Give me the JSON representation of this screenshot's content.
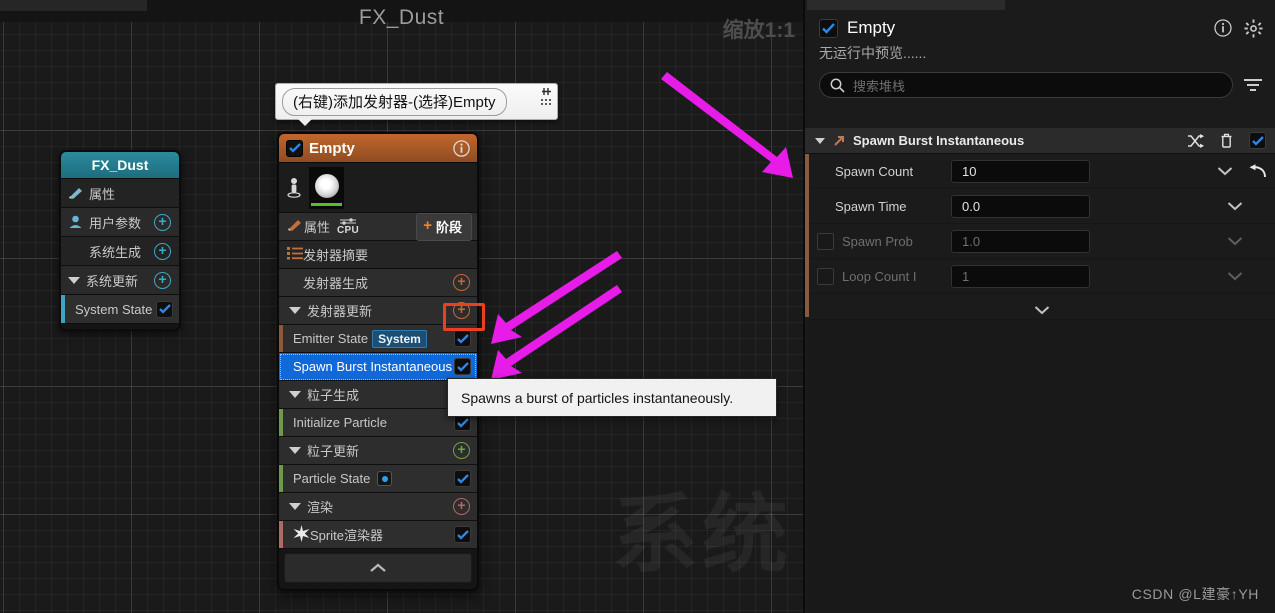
{
  "graph": {
    "title": "FX_Dust",
    "zoom_label": "缩放1:1",
    "background_watermark": "系统"
  },
  "callout": {
    "text": "(右键)添加发射器-(选择)Empty"
  },
  "system_node": {
    "title": "FX_Dust",
    "rows": [
      {
        "label": "属性",
        "icon": "pencil-icon",
        "has_plus": false,
        "has_check": false
      },
      {
        "label": "用户参数",
        "icon": "user-icon",
        "has_plus": true,
        "has_check": false
      },
      {
        "label": "系统生成",
        "icon": "none",
        "has_plus": true,
        "has_check": false
      },
      {
        "label": "系统更新",
        "icon": "caret-icon",
        "has_plus": true,
        "has_check": false
      },
      {
        "label": "System State",
        "icon": "none",
        "has_plus": false,
        "has_check": true
      }
    ]
  },
  "emitter_node": {
    "title": "Empty",
    "enabled": true,
    "properties_label": "属性",
    "cpu_label": "CPU",
    "stage_button": "阶段",
    "stage_plus": "+",
    "rows": [
      {
        "label": "发射器摘要",
        "type": "section",
        "icon": "list-icon"
      },
      {
        "label": "发射器生成",
        "type": "group",
        "plus": "orange"
      },
      {
        "label": "发射器更新",
        "type": "group",
        "plus": "orange",
        "highlighted": true
      },
      {
        "label": "Emitter State",
        "type": "module",
        "badge": "System",
        "stripe": "#8a5a3c",
        "checked": true
      },
      {
        "label": "Spawn Burst Instantaneous",
        "type": "module",
        "selected": true,
        "checked": true
      },
      {
        "label": "粒子生成",
        "type": "group",
        "plus": "none"
      },
      {
        "label": "Initialize Particle",
        "type": "module",
        "stripe": "#6f9a4e",
        "checked": true
      },
      {
        "label": "粒子更新",
        "type": "group",
        "plus": "green"
      },
      {
        "label": "Particle State",
        "type": "module",
        "stripe": "#6f9a4e",
        "checked": true,
        "dot": true
      },
      {
        "label": "渲染",
        "type": "group",
        "plus": "red"
      },
      {
        "label": "Sprite渲染器",
        "type": "module",
        "stripe": "#b06a64",
        "checked": true,
        "icon": "star-icon"
      }
    ]
  },
  "tooltip": {
    "text": "Spawns a burst of particles instantaneously."
  },
  "details_panel": {
    "title": "Empty",
    "enabled": true,
    "subtitle": "无运行中预览......",
    "search_placeholder": "搜索堆栈",
    "module": {
      "name": "Spawn Burst Instantaneous",
      "enabled": true
    },
    "properties": [
      {
        "name": "Spawn Count",
        "value": "10",
        "disabled": false,
        "has_checkbox": false,
        "has_reset": true
      },
      {
        "name": "Spawn Time",
        "value": "0.0",
        "disabled": false,
        "has_checkbox": false,
        "has_reset": false
      },
      {
        "name": "Spawn Prob",
        "value": "1.0",
        "disabled": true,
        "has_checkbox": true,
        "has_reset": false
      },
      {
        "name": "Loop Count I",
        "value": "1",
        "disabled": true,
        "has_checkbox": true,
        "has_reset": false
      }
    ]
  },
  "credit": "CSDN @L建豪↑YH",
  "colors": {
    "emitter_accent": "#c2662c",
    "system_accent": "#2b8b9c",
    "selection_blue": "#1168d8",
    "highlight_red": "#ec3e21",
    "arrow_magenta": "#e81ce8"
  }
}
